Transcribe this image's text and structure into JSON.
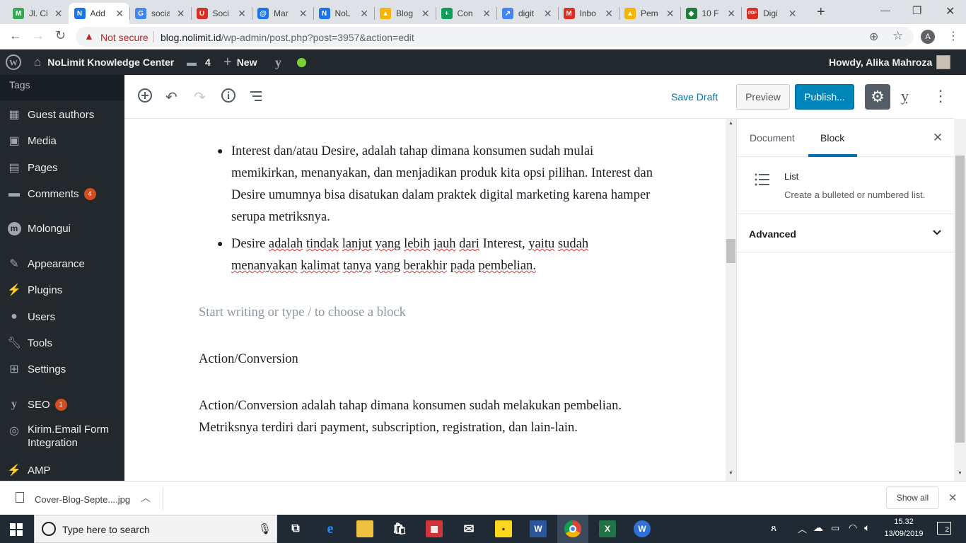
{
  "browser": {
    "tabs": [
      {
        "title": "Jl. Ci",
        "fav": "M",
        "color": "#34a853"
      },
      {
        "title": "Add",
        "fav": "N",
        "color": "#1a73e8"
      },
      {
        "title": "socia",
        "fav": "G",
        "color": "#4285f4"
      },
      {
        "title": "Soci",
        "fav": "U",
        "color": "#d93025"
      },
      {
        "title": "Mar",
        "fav": "@",
        "color": "#1a73e8"
      },
      {
        "title": "NoL",
        "fav": "N",
        "color": "#1a73e8"
      },
      {
        "title": "Blog",
        "fav": "▲",
        "color": "#f4b400"
      },
      {
        "title": "Con",
        "fav": "+",
        "color": "#0f9d58"
      },
      {
        "title": "digit",
        "fav": "↗",
        "color": "#4285f4"
      },
      {
        "title": "Inbo",
        "fav": "M",
        "color": "#d93025"
      },
      {
        "title": "Pem",
        "fav": "▲",
        "color": "#f4b400"
      },
      {
        "title": "10 F",
        "fav": "◆",
        "color": "#188038"
      },
      {
        "title": "Digi",
        "fav": "PDF",
        "color": "#d93025"
      }
    ],
    "new_tab": "+",
    "window_controls": {
      "minimize": "—",
      "restore": "❐",
      "close": "✕"
    },
    "security": "Not secure",
    "url_host": "blog.nolimit.id",
    "url_path": "/wp-admin/post.php?post=3957&action=edit",
    "profile_initial": "A"
  },
  "adminbar": {
    "site_name": "NoLimit Knowledge Center",
    "comments_count": "4",
    "new_label": "New",
    "greeting": "Howdy, Alika Mahroza"
  },
  "sidebar": {
    "items": [
      {
        "label": "Tags",
        "icon": "none"
      },
      {
        "label": "Guest authors",
        "icon": "users-icon"
      },
      {
        "label": "Media",
        "icon": "media-icon"
      },
      {
        "label": "Pages",
        "icon": "pages-icon"
      },
      {
        "label": "Comments",
        "icon": "comments-icon",
        "badge": "4"
      },
      {
        "label": "Molongui",
        "icon": "molongui-icon"
      },
      {
        "label": "Appearance",
        "icon": "brush-icon"
      },
      {
        "label": "Plugins",
        "icon": "plugin-icon"
      },
      {
        "label": "Users",
        "icon": "user-icon"
      },
      {
        "label": "Tools",
        "icon": "wrench-icon"
      },
      {
        "label": "Settings",
        "icon": "settings-icon"
      },
      {
        "label": "SEO",
        "icon": "yoast-icon",
        "badge": "1"
      },
      {
        "label": "Kirim.Email Form Integration",
        "icon": "kirim-icon"
      },
      {
        "label": "AMP",
        "icon": "amp-icon"
      }
    ]
  },
  "toolbar": {
    "save_draft": "Save Draft",
    "preview": "Preview",
    "publish": "Publish..."
  },
  "content": {
    "bullet1": "Interest dan/atau Desire, adalah tahap dimana konsumen sudah mulai memikirkan, menanyakan, dan menjadikan produk  kita opsi pilihan. Interest dan Desire umumnya bisa disatukan dalam praktek digital marketing karena hamper serupa metriksnya.",
    "bullet2_line1": [
      "Desire",
      "adalah",
      "tindak",
      "lanjut",
      "yang",
      "lebih",
      "jauh",
      "dari",
      "Interest,",
      "yaitu",
      "sudah"
    ],
    "bullet2_line2": [
      "menanyakan",
      "kalimat",
      "tanya",
      "yang",
      "berakhir",
      "pada",
      "pembelian."
    ],
    "placeholder": "Start writing or type / to choose a block",
    "heading": "Action/Conversion",
    "paragraph": "Action/Conversion adalah tahap dimana konsumen sudah melakukan pembelian. Metriksnya terdiri dari payment, subscription, registration, dan lain-lain."
  },
  "panel": {
    "tab_document": "Document",
    "tab_block": "Block",
    "block_name": "List",
    "block_desc": "Create a bulleted or numbered list.",
    "advanced": "Advanced"
  },
  "download": {
    "filename": "Cover-Blog-Septe....jpg",
    "show_all": "Show all"
  },
  "taskbar": {
    "search_placeholder": "Type here to search",
    "time": "15.32",
    "date": "13/09/2019",
    "notifications": "2"
  }
}
